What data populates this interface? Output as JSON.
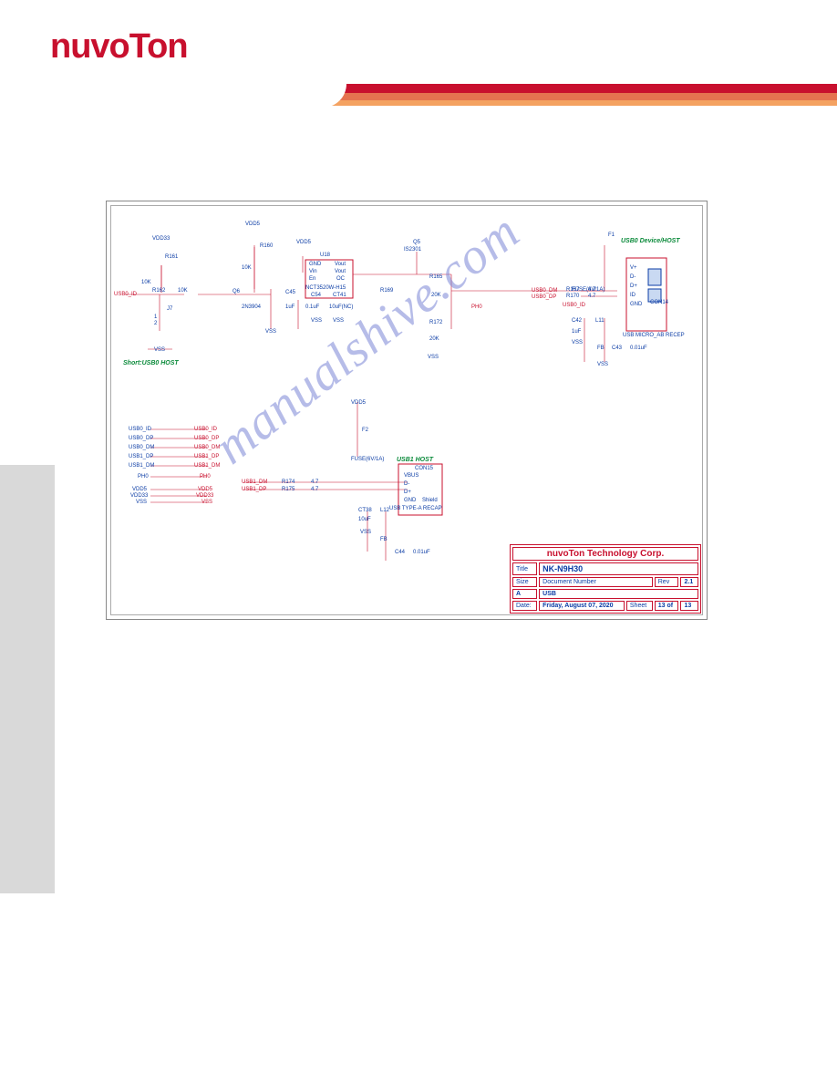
{
  "header": {
    "logo": "nuvoTon"
  },
  "watermark": "manualshive.com",
  "schematic": {
    "section_labels": {
      "short_host": "Short:USB0   HOST",
      "usb0_dev": "USB0   Device/HOST",
      "usb1_host": "USB1   HOST"
    },
    "power": {
      "vdd33": "VDD33",
      "vdd5_a": "VDD5",
      "vdd5_b": "VDD5",
      "vdd5_c": "VDD5",
      "vss": "VSS"
    },
    "top_left": {
      "r161": "R161",
      "r161_val": "10K",
      "r162": "R162",
      "r162_val": "10K",
      "usb0_id": "USB0_ID",
      "j7": "J7",
      "j7_p1": "1",
      "j7_p2": "2"
    },
    "transistor": {
      "r160": "R160",
      "r160_val": "10K",
      "q6": "Q6",
      "q6_part": "2N3904",
      "c45": "C45",
      "c45_val": "1uF"
    },
    "regulator": {
      "u18": "U18",
      "part": "NCT3520W-H15",
      "p1": "GND",
      "p2": "Vin",
      "p3": "En",
      "p4": "Vout",
      "p5": "Vout",
      "p6": "OC",
      "c54": "C54",
      "c54_val": "0.1uF",
      "ct41": "CT41",
      "ct41_val": "10uF(NC)"
    },
    "mosfet": {
      "q5": "Q5",
      "q5_part": "IS2301",
      "r169": "R169",
      "r165": "R165",
      "r165_val": "20K",
      "r172": "R172",
      "r172_val": "20K",
      "ph0": "PH0"
    },
    "usb0": {
      "f1": "F1",
      "fuse": "FUSE(6V/1A)",
      "dm": "USB0_DM",
      "dp": "USB0_DP",
      "id": "USB0_ID",
      "r167": "R167",
      "r167_val": "4.7",
      "r170": "R170",
      "r170_val": "4.7",
      "c42": "C42",
      "c42_val": "1uF",
      "l11": "L11",
      "fb": "FB",
      "c43": "C43",
      "c43_val": "0.01uF",
      "conn": "CON14",
      "conn_type": "USB MICRO_AB RECEP",
      "pins": {
        "1": "V+",
        "2": "D-",
        "3": "D+",
        "4": "ID",
        "5": "GND"
      }
    },
    "usb_nets": {
      "items": [
        "USB0_ID",
        "USB0_DP",
        "USB0_DM",
        "USB1_DP",
        "USB1_DM",
        "PH0"
      ],
      "labels": {
        "usb0_id_l": "USB0_ID",
        "usb0_id_r": "USB0_ID",
        "usb0_dp_l": "USB0_DP",
        "usb0_dp_r": "USB0_DP",
        "usb0_dm_l": "USB0_DM",
        "usb0_dm_r": "USB0_DM",
        "usb1_dp_l": "USB1_DP",
        "usb1_dp_r": "USB1_DP",
        "usb1_dm_l": "USB1_DM",
        "usb1_dm_r": "USB1_DM",
        "ph0_l": "PH0",
        "ph0_r": "PH0"
      },
      "pwr": {
        "vdd5": "VDD5",
        "vdd5_r": "VDD5",
        "vdd33": "VDD33",
        "vdd33_r": "VDD33",
        "vss": "VSS",
        "vss_r": "VSS"
      }
    },
    "usb1": {
      "f2": "F2",
      "fuse": "FUSE(6V/1A)",
      "dm": "USB1_DM",
      "dp": "USB1_DP",
      "r174": "R174",
      "r174_val": "4.7",
      "r175": "R175",
      "r175_val": "4.7",
      "ct38": "CT38",
      "ct38_val": "10uF",
      "l12": "L12",
      "fb": "FB",
      "c44": "C44",
      "c44_val": "0.01uF",
      "conn": "CON15",
      "conn_type": "USB TYPE-A RECAP",
      "pins": {
        "1": "VBUS",
        "2": "D-",
        "3": "D+",
        "4": "GND",
        "5": "Shield",
        "6": "Shield"
      }
    }
  },
  "title_block": {
    "company": "nuvoTon Technology Corp.",
    "title_label": "Title",
    "title": "NK-N9H30",
    "size_label": "Size",
    "size": "A",
    "docnum_label": "Document Number",
    "docnum": "USB",
    "rev_label": "Rev",
    "rev": "2.1",
    "date_label": "Date:",
    "date": "Friday, August 07, 2020",
    "sheet_label": "Sheet",
    "sheet": "13",
    "of_label": "of",
    "of": "13"
  }
}
